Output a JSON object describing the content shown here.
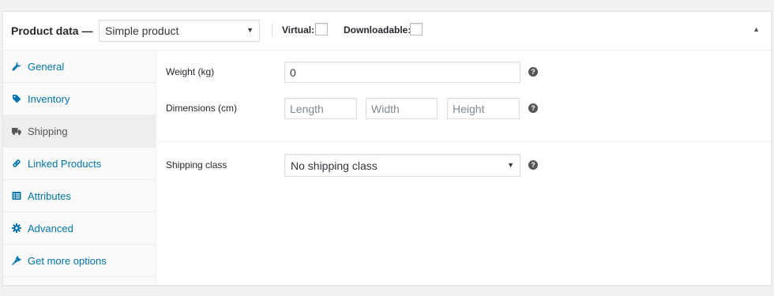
{
  "header": {
    "title": "Product data —",
    "product_type": "Simple product",
    "virtual_label": "Virtual:",
    "virtual_checked": false,
    "downloadable_label": "Downloadable:",
    "downloadable_checked": false,
    "collapse_icon": "triangle-up-icon"
  },
  "tabs": [
    {
      "label": "General",
      "icon": "wrench-icon",
      "active": false
    },
    {
      "label": "Inventory",
      "icon": "tag-icon",
      "active": false
    },
    {
      "label": "Shipping",
      "icon": "truck-icon",
      "active": true
    },
    {
      "label": "Linked Products",
      "icon": "link-icon",
      "active": false
    },
    {
      "label": "Attributes",
      "icon": "list-icon",
      "active": false
    },
    {
      "label": "Advanced",
      "icon": "gear-icon",
      "active": false
    },
    {
      "label": "Get more options",
      "icon": "plug-icon",
      "active": false
    }
  ],
  "shipping": {
    "weight_label": "Weight (kg)",
    "weight_value": "0",
    "dimensions_label": "Dimensions (cm)",
    "length_placeholder": "Length",
    "width_placeholder": "Width",
    "height_placeholder": "Height",
    "class_label": "Shipping class",
    "class_value": "No shipping class",
    "help_glyph": "?"
  },
  "colors": {
    "link": "#0073aa",
    "active_tab_bg": "#eeeeee",
    "help_bg": "#555555"
  }
}
